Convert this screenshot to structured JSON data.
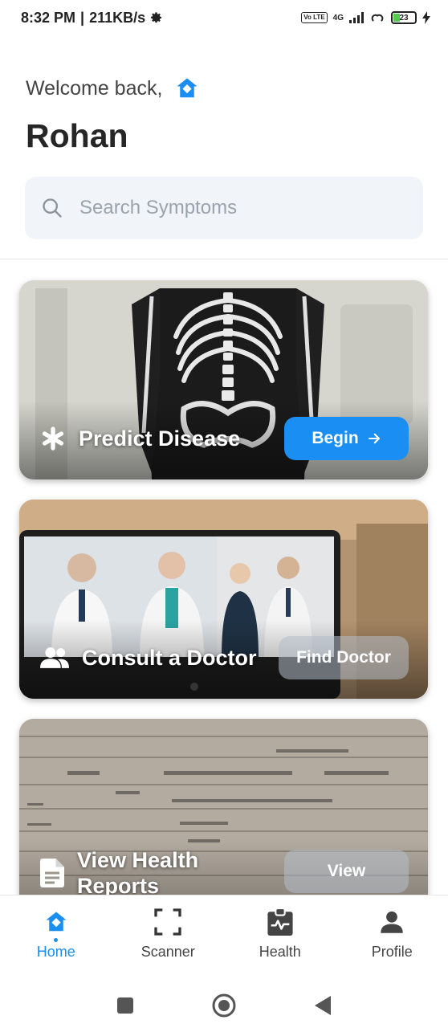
{
  "status_bar": {
    "time": "8:32 PM",
    "separator": "|",
    "speed": "211KB/s",
    "volte": "Vo LTE",
    "network": "4G",
    "battery": "23"
  },
  "header": {
    "welcome": "Welcome back,",
    "username": "Rohan"
  },
  "search": {
    "placeholder": "Search Symptoms"
  },
  "cards": [
    {
      "title": "Predict Disease",
      "button": "Begin",
      "icon": "asterisk-icon"
    },
    {
      "title": "Consult a Doctor",
      "button": "Find Doctor",
      "icon": "people-icon"
    },
    {
      "title_line1": "View Health",
      "title_line2": "Reports",
      "button": "View",
      "icon": "document-icon"
    }
  ],
  "bottom_nav": [
    {
      "label": "Home",
      "icon": "home-icon",
      "active": true
    },
    {
      "label": "Scanner",
      "icon": "scanner-icon",
      "active": false
    },
    {
      "label": "Health",
      "icon": "health-icon",
      "active": false
    },
    {
      "label": "Profile",
      "icon": "profile-icon",
      "active": false
    }
  ],
  "colors": {
    "accent": "#1a8ef2",
    "search_bg": "#f1f4f8",
    "text": "#262626"
  }
}
